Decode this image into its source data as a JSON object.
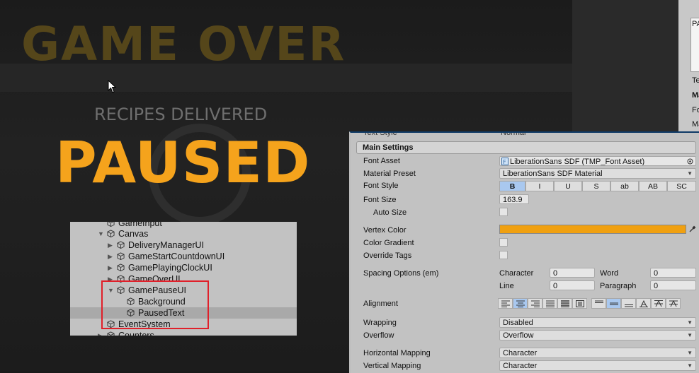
{
  "game": {
    "game_over": "GAME OVER",
    "recipes_delivered": "RECIPES DELIVERED",
    "paused": "PAUSED",
    "paused_color": "#f5a31c"
  },
  "right_panel": {
    "field_text": "PA",
    "row1": "Te",
    "row2": "Ma",
    "row3": "Fo",
    "row4": "Ma"
  },
  "hierarchy": {
    "rows": [
      {
        "label": "GameInput",
        "arrow": ""
      },
      {
        "label": "Canvas",
        "arrow": "▼"
      },
      {
        "label": "DeliveryManagerUI",
        "arrow": "▶"
      },
      {
        "label": "GameStartCountdownUI",
        "arrow": "▶"
      },
      {
        "label": "GamePlayingClockUI",
        "arrow": "▶"
      },
      {
        "label": "GameOverUI",
        "arrow": "▶"
      },
      {
        "label": "GamePauseUI",
        "arrow": "▼"
      },
      {
        "label": "Background",
        "arrow": ""
      },
      {
        "label": "PausedText",
        "arrow": ""
      },
      {
        "label": "EventSystem",
        "arrow": ""
      },
      {
        "label": "Counters",
        "arrow": "▶"
      }
    ],
    "highlight_color": "#e0202a"
  },
  "inspector": {
    "text_style_label": "Text Style",
    "text_style_value": "Normal",
    "main_settings": "Main Settings",
    "font_asset_label": "Font Asset",
    "font_asset_value": "LiberationSans SDF (TMP_Font Asset)",
    "material_preset_label": "Material Preset",
    "material_preset_value": "LiberationSans SDF Material",
    "font_style_label": "Font Style",
    "font_style_buttons": [
      "B",
      "I",
      "U",
      "S",
      "ab",
      "AB",
      "SC"
    ],
    "font_size_label": "Font Size",
    "font_size_value": "163.9",
    "auto_size_label": "Auto Size",
    "vertex_color_label": "Vertex Color",
    "vertex_color": "#f0a010",
    "color_gradient_label": "Color Gradient",
    "override_tags_label": "Override Tags",
    "spacing_label": "Spacing Options (em)",
    "character_label": "Character",
    "character_value": "0",
    "word_label": "Word",
    "word_value": "0",
    "line_label": "Line",
    "line_value": "0",
    "paragraph_label": "Paragraph",
    "paragraph_value": "0",
    "alignment_label": "Alignment",
    "wrapping_label": "Wrapping",
    "wrapping_value": "Disabled",
    "overflow_label": "Overflow",
    "overflow_value": "Overflow",
    "hmap_label": "Horizontal Mapping",
    "hmap_value": "Character",
    "vmap_label": "Vertical Mapping",
    "vmap_value": "Character"
  }
}
